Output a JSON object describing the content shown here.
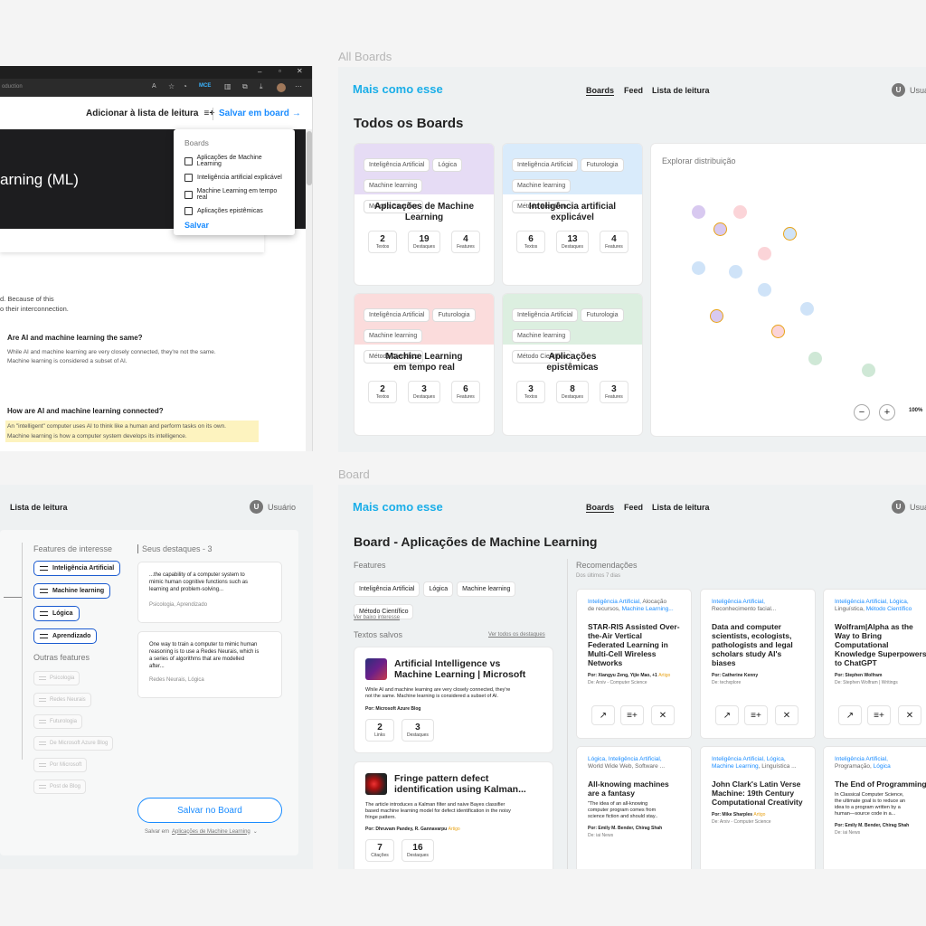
{
  "browser": {
    "tab_fragment": "oduction",
    "mce_badge": "MCE",
    "page_heading_fragment": "arning (ML)",
    "add_to_reading_list": "Adicionar à lista de leitura",
    "save_to_board": "Salvar em board",
    "popover": {
      "title": "Boards",
      "options": [
        "Aplicações de Machine Learning",
        "Inteligência artificial explicável",
        "Machine Learning em tempo real",
        "Aplicações epistêmicas"
      ],
      "save": "Salvar"
    },
    "article": {
      "frag1": "d. Because of this",
      "frag2": "o their interconnection.",
      "q1": "Are AI and machine learning the same?",
      "a1_l1": "While AI and machine learning are very closely connected, they're not the same.",
      "a1_l2": "Machine learning is considered a subset of AI.",
      "q2": "How are AI and machine learning connected?",
      "a2_l1": "An \"intelligent\" computer uses AI to think like a human and perform tasks on its own.",
      "a2_l2": "Machine learning is how a computer system develops its intelligence."
    }
  },
  "all_boards": {
    "frame_label": "All Boards",
    "logo": "Mais como esse",
    "nav": [
      "Boards",
      "Feed",
      "Lista de leitura"
    ],
    "user": "Usuá",
    "avatar": "U",
    "title": "Todos os Boards",
    "cards": [
      {
        "tags": [
          "Inteligência Artificial",
          "Lógica",
          "Machine learning",
          "Método Científico"
        ],
        "title_l1": "Aplicações de Machine",
        "title_l2": "Learning",
        "stats": [
          [
            "2",
            "Textos"
          ],
          [
            "19",
            "Destaques"
          ],
          [
            "4",
            "Features"
          ]
        ],
        "color": "#e6dcf5"
      },
      {
        "tags": [
          "Inteligência Artificial",
          "Futurologia",
          "Machine learning",
          "Método Científico"
        ],
        "title_l1": "Inteligência artificial",
        "title_l2": "explicável",
        "stats": [
          [
            "6",
            "Textos"
          ],
          [
            "13",
            "Destaques"
          ],
          [
            "4",
            "Features"
          ]
        ],
        "color": "#d9ebfb"
      },
      {
        "tags": [
          "Inteligência Artificial",
          "Futurologia",
          "Machine learning",
          "Método Científico"
        ],
        "title_l1": "Machine Learning",
        "title_l2": "em tempo real",
        "stats": [
          [
            "2",
            "Textos"
          ],
          [
            "3",
            "Destaques"
          ],
          [
            "6",
            "Features"
          ]
        ],
        "color": "#fbdcdc"
      },
      {
        "tags": [
          "Inteligência Artificial",
          "Futurologia",
          "Machine learning",
          "Método Científico"
        ],
        "title_l1": "Aplicações",
        "title_l2": "epistêmicas",
        "stats": [
          [
            "3",
            "Textos"
          ],
          [
            "8",
            "Destaques"
          ],
          [
            "3",
            "Features"
          ]
        ],
        "color": "#dcefe0"
      }
    ],
    "explore": "Explorar distribuição",
    "zoom": "100%"
  },
  "reading": {
    "nav_item": "Lista de leitura",
    "user": "Usuário",
    "avatar": "U",
    "features_title": "Features de interesse",
    "features": [
      "Inteligência Artificial",
      "Machine learning",
      "Lógica",
      "Aprendizado"
    ],
    "other_title": "Outras features",
    "other": [
      "Psicologia",
      "Redes Neurais",
      "Futurologia",
      "De Microsoft Azure Blog",
      "Por Microsoft",
      "Post de Blog"
    ],
    "highlights_title": "Seus destaques - 3",
    "highlights": [
      {
        "l1": "...the capability of a computer system to",
        "l2": "mimic human cognitive functions such as",
        "l3": "learning and problem-solving...",
        "tags": "Psicologia, Aprendizado"
      },
      {
        "l1": "One way to train a computer to mimic human",
        "l2": "reasoning is to use a Redes Neurais, which is",
        "l3": "a series of algorithms that are modelled",
        "l4": "after...",
        "tags": "Redes Neurais, Lógica"
      }
    ],
    "save_button": "Salvar no Board",
    "save_in_prefix": "Salvar em",
    "save_in_board": "Aplicações de Machine Learning"
  },
  "board": {
    "frame_label": "Board",
    "logo": "Mais como esse",
    "nav": [
      "Boards",
      "Feed",
      "Lista de leitura"
    ],
    "user": "Usuá",
    "avatar": "U",
    "title": "Board - Aplicações de Machine Learning",
    "features_title": "Features",
    "features": [
      "Inteligência Artificial",
      "Lógica",
      "Machine learning",
      "Método Científico"
    ],
    "low_interest": "Ver baixo interesse",
    "saved_title": "Textos salvos",
    "see_all": "Ver todos os destaques",
    "texts": [
      {
        "t1": "Artificial Intelligence vs",
        "t2": "Machine Learning | Microsoft",
        "d1": "While AI and machine learning are very closely connected, they're",
        "d2": "not the same. Machine learning is considered a subset of AI.",
        "by": "Por: Microsoft Azure Blog",
        "s1": [
          "2",
          "Links"
        ],
        "s2": [
          "3",
          "Destaques"
        ]
      },
      {
        "t1": "Fringe pattern defect",
        "t2": "identification using Kalman...",
        "d1": "The article introduces a Kalman filter and naive Bayes classifier",
        "d2": "based machine learning model for defect identification in the noisy",
        "d3": "fringe pattern.",
        "by": "Por: Dhruvam Pandey, R. Gannavarpu",
        "badge": "Artigo",
        "s1": [
          "7",
          "Citações"
        ],
        "s2": [
          "16",
          "Destaques"
        ]
      }
    ],
    "rec_title": "Recomendações",
    "rec_sub": "Dos últimos 7 dias",
    "recs": [
      {
        "c1": "Inteligência Artificial,",
        "c1b": " Alocação",
        "c2a": "de recursos, ",
        "c2b": "Machine Learning...",
        "t": [
          "STAR-RIS Assisted Over-",
          "the-Air Vertical",
          "Federated Learning in",
          "Multi-Cell Wireless",
          "Networks"
        ],
        "by": "Por: Xiangyu Zeng, Yijie Mao, +1",
        "badge": "Artigo",
        "src": "De: Arxiv - Computer Science"
      },
      {
        "c1": "Inteligência Artificial,",
        "c1b": "",
        "c2a": "Reconhecimento facial...",
        "c2b": "",
        "t": [
          "Data and computer",
          "scientists, ecologists,",
          "pathologists and legal",
          "scholars study AI's",
          "biases"
        ],
        "by": "Por: Catherine Kenny",
        "badge": "",
        "src": "De: techxplore"
      },
      {
        "c1": "Inteligência Artificial, Lógica,",
        "c1b": "",
        "c2a": "Linguística, ",
        "c2b": "Método Científico",
        "t": [
          "Wolfram|Alpha as the",
          "Way to Bring",
          "Computational",
          "Knowledge Superpowers",
          "to ChatGPT"
        ],
        "by": "Por: Stephen Wolfram",
        "badge": "",
        "src": "De: Stephen Wolfram | Writings"
      },
      {
        "c1": "Lógica, Inteligência Artificial,",
        "c1b": "",
        "c2a": "World Wide Web, Software ...",
        "c2b": "",
        "t": [
          "All-knowing machines",
          "are a fantasy"
        ],
        "d": [
          "\"The idea of an all-knowing",
          "computer program comes from",
          "science fiction and should stay.."
        ],
        "by": "Por: Emily M. Bender, Chirag Shah",
        "badge": "",
        "src": "De: iai News"
      },
      {
        "c1": "Inteligência Artificial, Lógica,",
        "c1b": "",
        "c2a": "",
        "c2b": "Machine Learning",
        "c2c": ", Linguística ...",
        "t": [
          "John Clark's Latin Verse",
          "Machine: 19th Century",
          "Computational Creativity"
        ],
        "by": "Por: Mike Sharples",
        "badge": "Artigo",
        "src": "De: Arxiv - Computer Science"
      },
      {
        "c1": "Inteligência Artificial,",
        "c1b": "",
        "c2a": "Programação, ",
        "c2b": "Lógica",
        "t": [
          "The End of Programming"
        ],
        "d": [
          "In Classical Computer Science,",
          "the ultimate goal is to reduce an",
          "idea to a program written by a",
          "human—source code in a..."
        ],
        "by": "Por: Emily M. Bender, Chirag Shah",
        "badge": "",
        "src": "De: iai News"
      }
    ]
  },
  "icons": [
    "close-icon",
    "maximize-icon",
    "minimize-icon",
    "arrow-right-icon",
    "playlist-add-icon",
    "zoom-in-icon",
    "zoom-out-icon",
    "external-link-icon",
    "chevron-down-icon",
    "drag-handle-icon"
  ]
}
